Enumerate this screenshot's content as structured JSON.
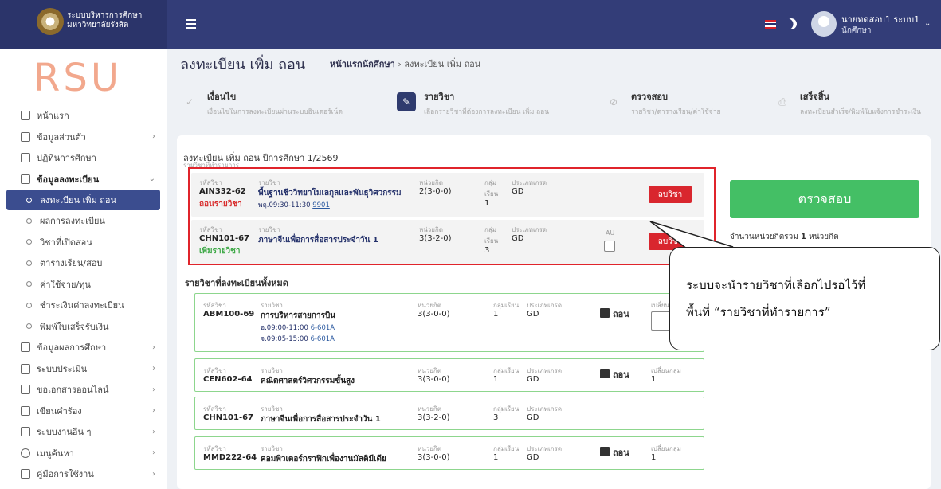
{
  "header": {
    "org_line1": "ระบบบริหารการศึกษา",
    "org_line2": "มหาวิทยาลัยรังสิต",
    "user_name": "นายทดสอบ1 ระบบ1",
    "user_role": "นักศึกษา"
  },
  "sidebar": {
    "logo": "RSU",
    "items": [
      {
        "label": "หน้าแรก",
        "icon": "home-icon"
      },
      {
        "label": "ข้อมูลส่วนตัว",
        "icon": "id-card-icon",
        "chev": "›"
      },
      {
        "label": "ปฏิทินการศึกษา",
        "icon": "calendar-icon"
      },
      {
        "label": "ข้อมูลลงทะเบียน",
        "icon": "register-icon",
        "chev": "⌄"
      },
      {
        "label": "ข้อมูลผลการศึกษา",
        "icon": "result-icon",
        "chev": "›"
      },
      {
        "label": "ระบบประเมิน",
        "icon": "evaluate-icon",
        "chev": "›"
      },
      {
        "label": "ขอเอกสารออนไลน์",
        "icon": "document-icon",
        "chev": "›"
      },
      {
        "label": "เขียนคำร้อง",
        "icon": "petition-icon",
        "chev": "›"
      },
      {
        "label": "ระบบงานอื่น ๆ",
        "icon": "apps-icon",
        "chev": "›"
      },
      {
        "label": "เมนูค้นหา",
        "icon": "search-icon",
        "chev": "›"
      },
      {
        "label": "คู่มือการใช้งาน",
        "icon": "manual-icon",
        "chev": "›"
      }
    ],
    "subitems": [
      "ลงทะเบียน เพิ่ม ถอน",
      "ผลการลงทะเบียน",
      "วิชาที่เปิดสอน",
      "ตารางเรียน/สอบ",
      "ค่าใช้จ่าย/ทุน",
      "ชำระเงินค่าลงทะเบียน",
      "พิมพ์ใบเสร็จรับเงิน"
    ]
  },
  "page": {
    "title": "ลงทะเบียน เพิ่ม ถอน",
    "crumb_home": "หน้าแรกนักศึกษา",
    "crumb_sep": "›",
    "crumb_current": "ลงทะเบียน เพิ่ม ถอน"
  },
  "steps": [
    {
      "title": "เงื่อนไข",
      "sub": "เงื่อนไขในการลงทะเบียนผ่านระบบอินเตอร์เน็ต",
      "icon": "check-icon"
    },
    {
      "title": "รายวิชา",
      "sub": "เลือกรายวิชาที่ต้องการลงทะเบียน เพิ่ม ถอน",
      "icon": "pencil-icon"
    },
    {
      "title": "ตรวจสอบ",
      "sub": "รายวิชา/ตารางเรียน/ค่าใช้จ่าย",
      "icon": "check-circle-icon"
    },
    {
      "title": "เสร็จสิ้น",
      "sub": "ลงทะเบียนสำเร็จ/พิมพ์ใบแจ้งการชำระเงิน",
      "icon": "printer-icon"
    }
  ],
  "card": {
    "title": "ลงทะเบียน เพิ่ม ถอน ปีการศึกษา 1/2569",
    "subtitle": "รายวิชาที่ทำรายการ"
  },
  "labels": {
    "code": "รหัสวิชา",
    "name": "รายวิชา",
    "credit": "หน่วยกิต",
    "group": "กลุ่ม",
    "group2": "เรียน",
    "group_full": "กลุ่มเรียน",
    "grade": "ประเภทเกรด",
    "au": "AU",
    "change_group": "เปลี่ยนกลุ่ม",
    "remove": "ลบวิชา",
    "drop": "ถอน"
  },
  "selected": [
    {
      "code": "AIN332-62",
      "name": "พื้นฐานชีววิทยาโมเลกุลและพันธุวิศวกรรม",
      "credit": "2(3-0-0)",
      "group": "1",
      "grade": "GD",
      "action": "ถอนรายวิชา",
      "time": "พฤ.09:30-11:30",
      "room": "9901"
    },
    {
      "code": "CHN101-67",
      "name": "ภาษาจีนเพื่อการสื่อสารประจำวัน 1",
      "credit": "3(3-2-0)",
      "group": "3",
      "grade": "GD",
      "action": "เพิ่มรายวิชา"
    }
  ],
  "check_button": "ตรวจสอบ",
  "credit_total": {
    "prefix": "จำนวนหน่วยกิตรวม",
    "value": "1",
    "suffix": "หน่วยกิต"
  },
  "all_title": "รายวิชาที่ลงทะเบียนทั้งหมด",
  "all": [
    {
      "code": "ABM100-69",
      "name": "การบริหารสายการบิน",
      "credit": "3(3-0-0)",
      "group": "1",
      "grade": "GD",
      "t1": "อ.09:00-11:00",
      "r1": "6-601A",
      "t2": "จ.09:05-15:00",
      "r2": "6-601A"
    },
    {
      "code": "CEN602-64",
      "name": "คณิตศาสตร์วิศวกรรมขั้นสูง",
      "credit": "3(3-0-0)",
      "group": "1",
      "grade": "GD",
      "chg": "1"
    },
    {
      "code": "CHN101-67",
      "name": "ภาษาจีนเพื่อการสื่อสารประจำวัน 1",
      "credit": "3(3-2-0)",
      "group": "3",
      "grade": "GD"
    },
    {
      "code": "MMD222-64",
      "name": "คอมพิวเตอร์กราฟิกเพื่องานมัลติมีเดีย",
      "credit": "3(3-0-0)",
      "group": "1",
      "grade": "GD",
      "chg": "1"
    }
  ],
  "callout": {
    "line1": "ระบบจะนำรายวิชาที่เลือกไปรอไว้ที่",
    "line2": "พื้นที่ “รายวิชาที่ทำรายการ”"
  }
}
